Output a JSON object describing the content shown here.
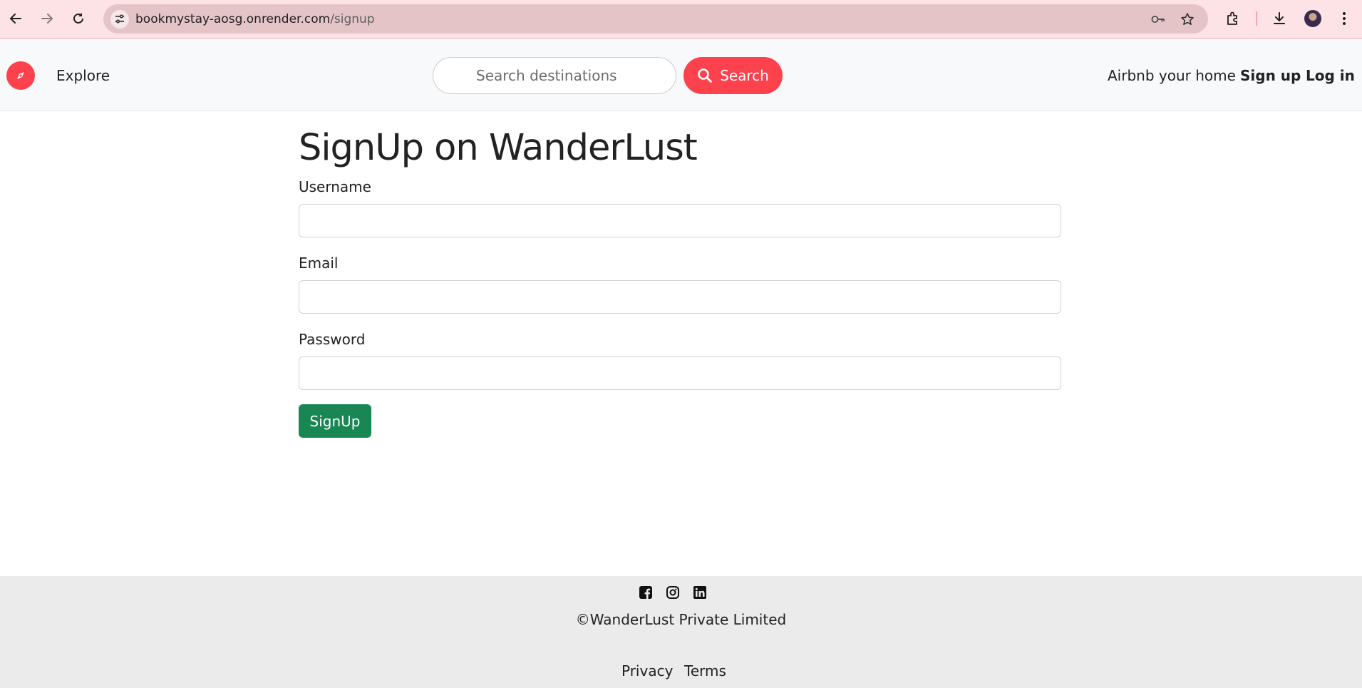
{
  "browser": {
    "url_host": "bookmystay-aosg.onrender.com",
    "url_path": "/signup",
    "icons": [
      "back-arrow-icon",
      "forward-arrow-icon",
      "reload-icon",
      "site-settings-icon",
      "password-key-icon",
      "bookmark-star-icon",
      "extensions-icon",
      "download-icon",
      "profile-avatar",
      "more-menu-icon"
    ]
  },
  "navbar": {
    "brand_icon": "compass-icon",
    "explore_label": "Explore",
    "search_placeholder": "Search destinations",
    "search_value": "",
    "search_button_label": "Search",
    "host_link": "Airbnb your home",
    "signup_link": "Sign up",
    "login_link": "Log in"
  },
  "colors": {
    "brand": "#fe424d",
    "submit": "#198754",
    "chrome_bg": "#fde3e6",
    "footer_bg": "#ebebeb"
  },
  "form": {
    "title": "SignUp on WanderLust",
    "fields": [
      {
        "label": "Username",
        "value": ""
      },
      {
        "label": "Email",
        "value": ""
      },
      {
        "label": "Password",
        "value": ""
      }
    ],
    "submit_label": "SignUp"
  },
  "footer": {
    "social_icons": [
      "facebook-icon",
      "instagram-icon",
      "linkedin-icon"
    ],
    "copyright": "©WanderLust Private Limited",
    "links": [
      "Privacy",
      "Terms"
    ]
  }
}
